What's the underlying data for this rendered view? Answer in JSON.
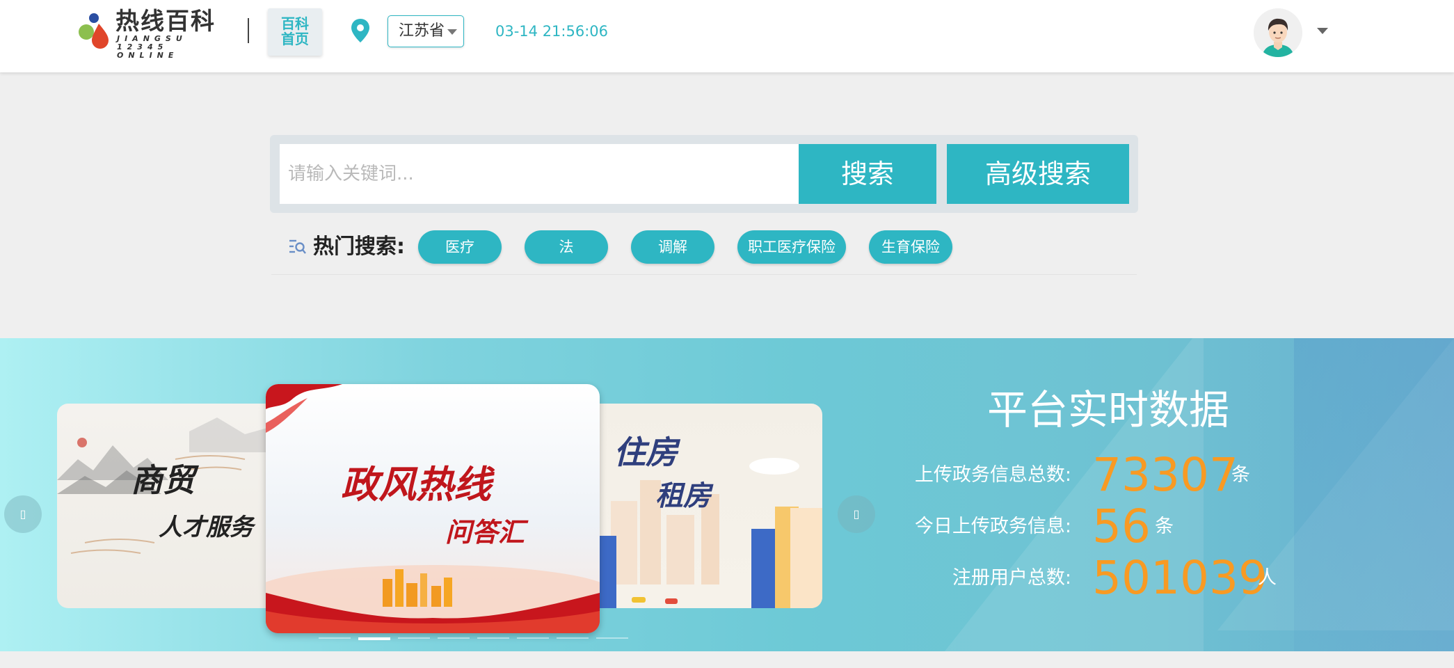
{
  "header": {
    "logo": {
      "title": "热线百科",
      "sub1": "JIANGSU",
      "sub2": "12345 ONLINE"
    },
    "home_button": {
      "line1": "百科",
      "line2": "首页"
    },
    "province": "江苏省",
    "datetime": "03-14 21:56:06"
  },
  "search": {
    "placeholder": "请输入关键词...",
    "search_label": "搜索",
    "advanced_label": "高级搜索"
  },
  "hot_search": {
    "label": "热门搜索:",
    "tags": [
      "医疗",
      "法",
      "调解",
      "职工医疗保险",
      "生育保险"
    ]
  },
  "carousel": {
    "slides": [
      {
        "line1": "商贸",
        "line2": "人才服务"
      },
      {
        "line1": "政风热线",
        "line2": "问答汇"
      },
      {
        "line1": "住房",
        "line2": "租房"
      }
    ],
    "prev_glyph": "▯",
    "next_glyph": "▯",
    "indicator_count": 8,
    "active_indicator": 2
  },
  "stats": {
    "title": "平台实时数据",
    "rows": [
      {
        "label": "上传政务信息总数:",
        "value": "73307",
        "unit": "条"
      },
      {
        "label": "今日上传政务信息:",
        "value": "56",
        "unit": "条"
      },
      {
        "label": "注册用户总数:",
        "value": "501039",
        "unit": "人"
      }
    ]
  },
  "colors": {
    "accent": "#2eb6c3",
    "stat_value": "#f89a23",
    "page_bg": "#efefef"
  }
}
